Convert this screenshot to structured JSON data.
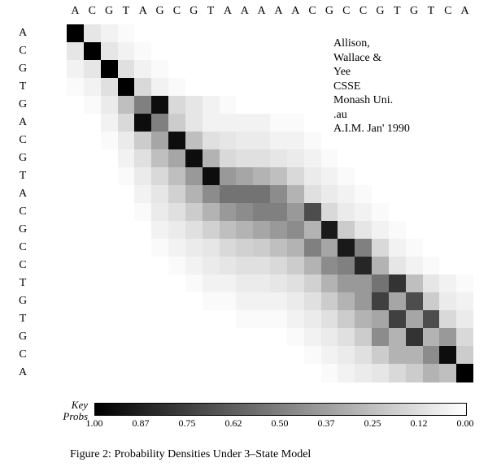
{
  "chart_data": {
    "type": "heatmap",
    "title": "Probability Densities Under 3-State Model",
    "x_categories": [
      "A",
      "C",
      "G",
      "T",
      "A",
      "G",
      "C",
      "G",
      "T",
      "A",
      "A",
      "A",
      "A",
      "A",
      "C",
      "G",
      "C",
      "C",
      "G",
      "T",
      "G",
      "T",
      "C",
      "A"
    ],
    "y_categories": [
      "A",
      "C",
      "G",
      "T",
      "G",
      "A",
      "C",
      "G",
      "T",
      "A",
      "C",
      "G",
      "C",
      "C",
      "T",
      "G",
      "T",
      "G",
      "C",
      "A"
    ],
    "zlabel": "Probability",
    "zrange": [
      0.0,
      1.0
    ],
    "grid": [
      [
        1.0,
        0.1,
        0.05,
        0.02,
        0.0,
        0.0,
        0.0,
        0.0,
        0.0,
        0.0,
        0.0,
        0.0,
        0.0,
        0.0,
        0.0,
        0.0,
        0.0,
        0.0,
        0.0,
        0.0,
        0.0,
        0.0,
        0.0,
        0.0
      ],
      [
        0.1,
        1.0,
        0.1,
        0.05,
        0.02,
        0.0,
        0.0,
        0.0,
        0.0,
        0.0,
        0.0,
        0.0,
        0.0,
        0.0,
        0.0,
        0.0,
        0.0,
        0.0,
        0.0,
        0.0,
        0.0,
        0.0,
        0.0,
        0.0
      ],
      [
        0.05,
        0.1,
        1.0,
        0.12,
        0.05,
        0.02,
        0.0,
        0.0,
        0.0,
        0.0,
        0.0,
        0.0,
        0.0,
        0.0,
        0.0,
        0.0,
        0.0,
        0.0,
        0.0,
        0.0,
        0.0,
        0.0,
        0.0,
        0.0
      ],
      [
        0.02,
        0.05,
        0.12,
        1.0,
        0.15,
        0.05,
        0.02,
        0.0,
        0.0,
        0.0,
        0.0,
        0.0,
        0.0,
        0.0,
        0.0,
        0.0,
        0.0,
        0.0,
        0.0,
        0.0,
        0.0,
        0.0,
        0.0,
        0.0
      ],
      [
        0.0,
        0.02,
        0.08,
        0.25,
        0.5,
        0.95,
        0.15,
        0.1,
        0.05,
        0.02,
        0.0,
        0.0,
        0.0,
        0.0,
        0.0,
        0.0,
        0.0,
        0.0,
        0.0,
        0.0,
        0.0,
        0.0,
        0.0,
        0.0
      ],
      [
        0.0,
        0.0,
        0.05,
        0.15,
        0.95,
        0.5,
        0.2,
        0.1,
        0.05,
        0.05,
        0.05,
        0.05,
        0.02,
        0.02,
        0.0,
        0.0,
        0.0,
        0.0,
        0.0,
        0.0,
        0.0,
        0.0,
        0.0,
        0.0
      ],
      [
        0.0,
        0.0,
        0.02,
        0.08,
        0.2,
        0.35,
        0.95,
        0.25,
        0.12,
        0.1,
        0.08,
        0.08,
        0.05,
        0.05,
        0.02,
        0.0,
        0.0,
        0.0,
        0.0,
        0.0,
        0.0,
        0.0,
        0.0,
        0.0
      ],
      [
        0.0,
        0.0,
        0.0,
        0.05,
        0.12,
        0.25,
        0.35,
        0.95,
        0.3,
        0.15,
        0.12,
        0.12,
        0.1,
        0.08,
        0.05,
        0.02,
        0.0,
        0.0,
        0.0,
        0.0,
        0.0,
        0.0,
        0.0,
        0.0
      ],
      [
        0.0,
        0.0,
        0.0,
        0.02,
        0.08,
        0.15,
        0.25,
        0.4,
        0.95,
        0.4,
        0.35,
        0.3,
        0.25,
        0.15,
        0.08,
        0.05,
        0.02,
        0.0,
        0.0,
        0.0,
        0.0,
        0.0,
        0.0,
        0.0
      ],
      [
        0.0,
        0.0,
        0.0,
        0.0,
        0.05,
        0.1,
        0.18,
        0.3,
        0.45,
        0.55,
        0.55,
        0.55,
        0.45,
        0.3,
        0.12,
        0.08,
        0.05,
        0.02,
        0.0,
        0.0,
        0.0,
        0.0,
        0.0,
        0.0
      ],
      [
        0.0,
        0.0,
        0.0,
        0.0,
        0.02,
        0.08,
        0.12,
        0.2,
        0.3,
        0.4,
        0.45,
        0.5,
        0.5,
        0.4,
        0.7,
        0.15,
        0.08,
        0.05,
        0.02,
        0.0,
        0.0,
        0.0,
        0.0,
        0.0
      ],
      [
        0.0,
        0.0,
        0.0,
        0.0,
        0.0,
        0.05,
        0.08,
        0.12,
        0.18,
        0.25,
        0.3,
        0.35,
        0.4,
        0.45,
        0.3,
        0.9,
        0.2,
        0.1,
        0.05,
        0.02,
        0.0,
        0.0,
        0.0,
        0.0
      ],
      [
        0.0,
        0.0,
        0.0,
        0.0,
        0.0,
        0.02,
        0.05,
        0.08,
        0.1,
        0.15,
        0.18,
        0.2,
        0.25,
        0.3,
        0.5,
        0.35,
        0.9,
        0.5,
        0.15,
        0.05,
        0.02,
        0.0,
        0.0,
        0.0
      ],
      [
        0.0,
        0.0,
        0.0,
        0.0,
        0.0,
        0.0,
        0.02,
        0.05,
        0.08,
        0.1,
        0.12,
        0.12,
        0.15,
        0.2,
        0.3,
        0.45,
        0.5,
        0.85,
        0.3,
        0.1,
        0.05,
        0.02,
        0.0,
        0.0
      ],
      [
        0.0,
        0.0,
        0.0,
        0.0,
        0.0,
        0.0,
        0.0,
        0.02,
        0.05,
        0.05,
        0.08,
        0.08,
        0.1,
        0.12,
        0.18,
        0.3,
        0.4,
        0.4,
        0.55,
        0.8,
        0.25,
        0.1,
        0.05,
        0.02
      ],
      [
        0.0,
        0.0,
        0.0,
        0.0,
        0.0,
        0.0,
        0.0,
        0.0,
        0.02,
        0.02,
        0.05,
        0.05,
        0.05,
        0.08,
        0.12,
        0.2,
        0.3,
        0.4,
        0.75,
        0.35,
        0.7,
        0.2,
        0.08,
        0.05
      ],
      [
        0.0,
        0.0,
        0.0,
        0.0,
        0.0,
        0.0,
        0.0,
        0.0,
        0.0,
        0.0,
        0.02,
        0.02,
        0.02,
        0.05,
        0.08,
        0.12,
        0.2,
        0.3,
        0.35,
        0.75,
        0.35,
        0.7,
        0.15,
        0.08
      ],
      [
        0.0,
        0.0,
        0.0,
        0.0,
        0.0,
        0.0,
        0.0,
        0.0,
        0.0,
        0.0,
        0.0,
        0.0,
        0.0,
        0.02,
        0.05,
        0.08,
        0.12,
        0.2,
        0.45,
        0.3,
        0.8,
        0.3,
        0.4,
        0.15
      ],
      [
        0.0,
        0.0,
        0.0,
        0.0,
        0.0,
        0.0,
        0.0,
        0.0,
        0.0,
        0.0,
        0.0,
        0.0,
        0.0,
        0.0,
        0.02,
        0.05,
        0.08,
        0.12,
        0.2,
        0.3,
        0.3,
        0.45,
        0.95,
        0.2
      ],
      [
        0.0,
        0.0,
        0.0,
        0.0,
        0.0,
        0.0,
        0.0,
        0.0,
        0.0,
        0.0,
        0.0,
        0.0,
        0.0,
        0.0,
        0.0,
        0.02,
        0.05,
        0.08,
        0.1,
        0.15,
        0.2,
        0.3,
        0.25,
        1.0
      ]
    ],
    "colorbar": {
      "label": "Key Probs",
      "ticks": [
        1.0,
        0.87,
        0.75,
        0.62,
        0.5,
        0.37,
        0.25,
        0.12,
        0.0
      ]
    }
  },
  "attribution": {
    "line1": "Allison,",
    "line2": "Wallace &",
    "line3": "Yee",
    "line4": "CSSE",
    "line5": "Monash Uni.",
    "line6": ".au",
    "line7": "A.I.M. Jan' 1990"
  },
  "key": {
    "title_line1": "Key",
    "title_line2": "Probs"
  },
  "caption": {
    "text": "Figure 2:  Probability Densities Under 3–State Model"
  }
}
